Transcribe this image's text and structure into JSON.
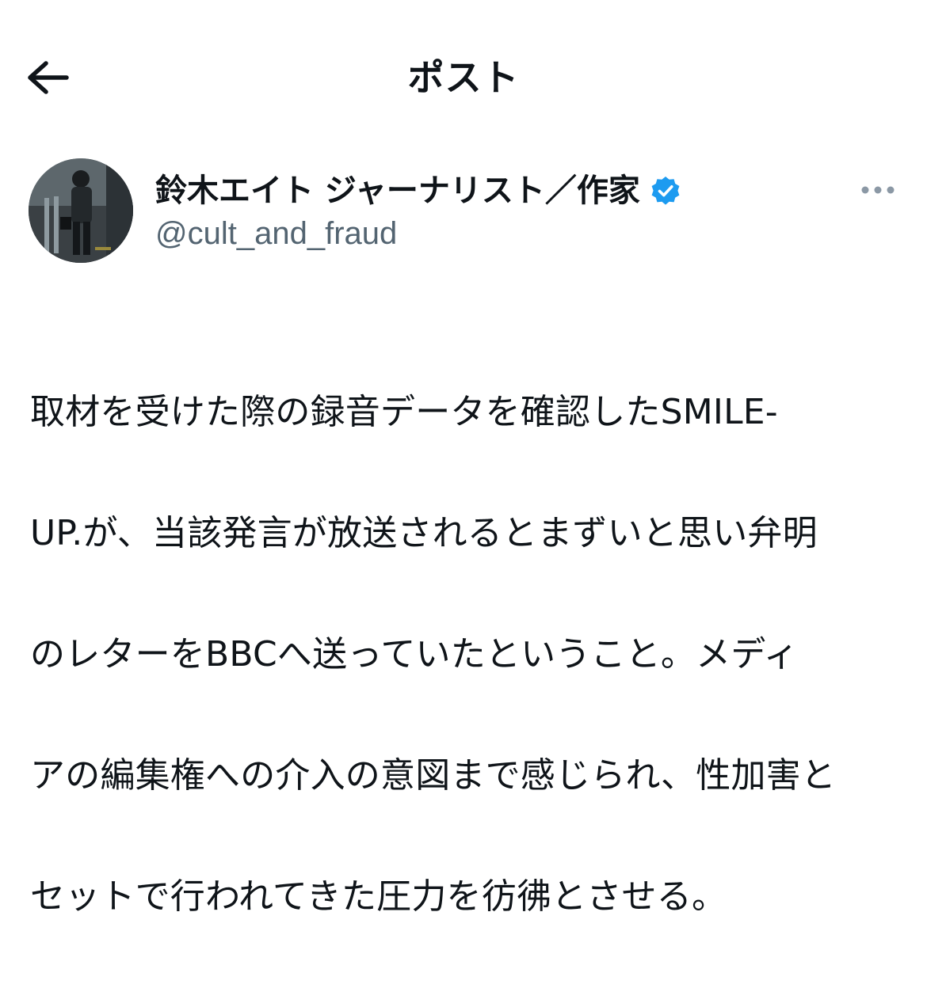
{
  "header": {
    "title": "ポスト",
    "back_icon": "arrow-left-icon"
  },
  "author": {
    "display_name": "鈴木エイト ジャーナリスト／作家",
    "handle": "@cult_and_fraud",
    "verified": true,
    "verified_color": "#1d9bf0",
    "more_icon": "more-horizontal-icon"
  },
  "post": {
    "lines": [
      "取材を受けた際の録音データを確認したSMILE-",
      "UP.が、当該発言が放送されるとまずいと思い弁明",
      "のレターをBBCへ送っていたということ。メディ",
      "アの編集権への介入の意図まで感じられ、性加害と",
      "セットで行われてきた圧力を彷彿とさせる。"
    ]
  },
  "colors": {
    "text": "#0f1419",
    "secondary": "#536471",
    "accent": "#1d9bf0",
    "background": "#ffffff"
  }
}
